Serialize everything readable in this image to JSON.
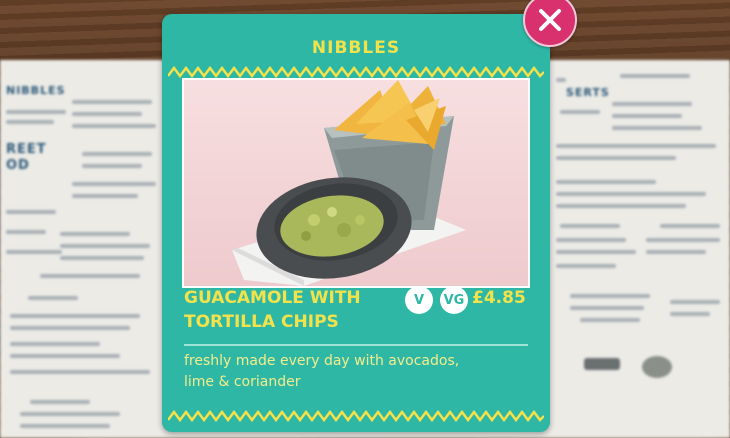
{
  "popup": {
    "section_title": "NIBBLES",
    "dish_name_line1": "GUACAMOLE WITH",
    "dish_name_line2": "TORTILLA CHIPS",
    "badges": [
      "V",
      "VG"
    ],
    "price": "£4.85",
    "description_line1": "freshly made every day with avocados,",
    "description_line2": "lime & coriander",
    "close_icon": "close-icon",
    "colors": {
      "card": "#2fb7a6",
      "accent_yellow": "#f2e24b",
      "close_button": "#d9306e"
    }
  },
  "background_menu": {
    "left_heading": "NIBBLES",
    "left_heading_2a": "REET",
    "left_heading_2b": "OD",
    "right_heading": "SERTS"
  }
}
